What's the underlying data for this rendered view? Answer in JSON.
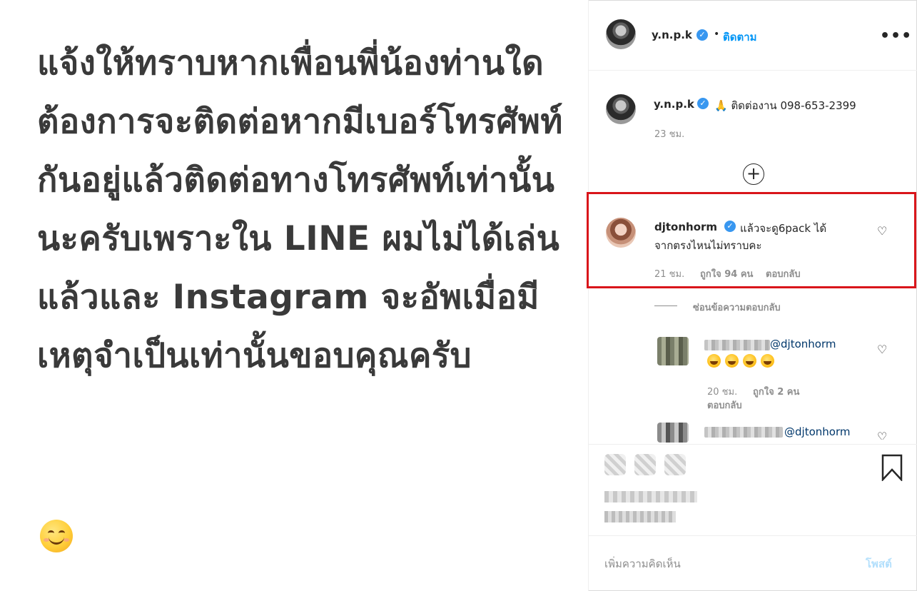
{
  "post": {
    "text": "แจ้งให้ทราบหากเพื่อนพี่น้องท่านใดต้องการจะติดต่อหากมีเบอร์โทรศัพท์กันอยู่แล้วติดต่อทางโทรศัพท์เท่านั้นนะครับเพราะใน LINE ผมไม่ได้เล่นแล้วและ Instagram จะอัพเมื่อมีเหตุจำเป็นเท่านั้นขอบคุณครับ",
    "emoji": "smiling-face"
  },
  "header": {
    "username": "y.n.p.k",
    "separator": "•",
    "follow_label": "ติดตาม",
    "more_label": "•••"
  },
  "caption": {
    "username": "y.n.p.k",
    "text": "🙏 ติดต่องาน 098-653-2399",
    "time": "23 ชม."
  },
  "load_more_icon": "plus-circle-icon",
  "comment": {
    "username": "djtonhorm",
    "text_line1": "แล้วจะดู6pack ได้",
    "text_line2": "จากตรงไหนไม่ทราบคะ",
    "time": "21 ชม.",
    "likes": "ถูกใจ 94 คน",
    "reply_label": "ตอบกลับ",
    "hide_replies_label": "ซ่อนข้อความตอบกลับ"
  },
  "replies": [
    {
      "mention": "@djtonhorm",
      "emojis": "🤣🤣🤣🤣",
      "time": "20 ชม.",
      "likes": "ถูกใจ 2 คน",
      "reply_label": "ตอบกลับ"
    },
    {
      "mention": "@djtonhorm"
    }
  ],
  "footer": {
    "add_comment_placeholder": "เพิ่มความคิดเห็น",
    "post_label": "โพสต์"
  },
  "colors": {
    "link_blue": "#0095f6",
    "verified_blue": "#3897f0",
    "highlight_red": "#d9151a",
    "muted_text": "#8e8e8e"
  }
}
